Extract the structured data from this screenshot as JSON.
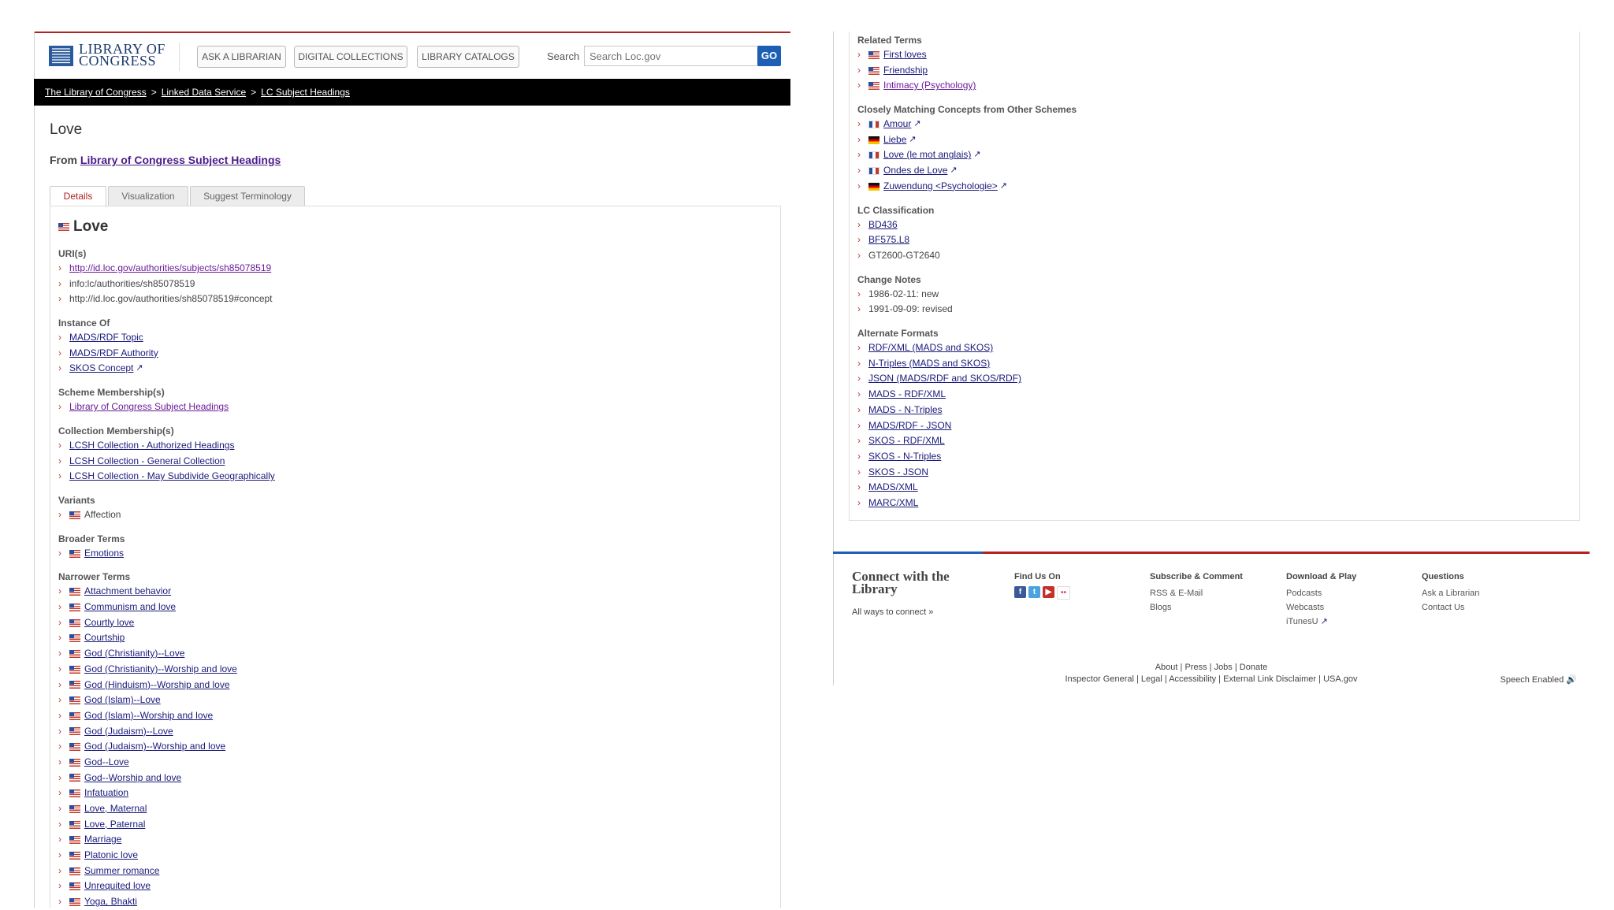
{
  "header": {
    "logo_line1": "LIBRARY OF",
    "logo_line2": "CONGRESS",
    "buttons": [
      "ASK A LIBRARIAN",
      "DIGITAL COLLECTIONS",
      "LIBRARY CATALOGS"
    ],
    "search_label": "Search",
    "search_placeholder": "Search Loc.gov",
    "go_label": "GO"
  },
  "breadcrumb": [
    "The Library of Congress",
    "Linked Data Service",
    "LC Subject Headings"
  ],
  "breadcrumb_sep": ">",
  "page_title": "Love",
  "from_label": "From",
  "from_link": "Library of Congress Subject Headings",
  "tabs": [
    "Details",
    "Visualization",
    "Suggest Terminology"
  ],
  "term_heading": "Love",
  "sections_left": [
    {
      "title": "URI(s)",
      "items": [
        {
          "text": "http://id.loc.gov/authorities/subjects/sh85078519",
          "link": true
        },
        {
          "text": "info:lc/authorities/sh85078519",
          "link": false
        },
        {
          "text": "http://id.loc.gov/authorities/sh85078519#concept",
          "link": false
        }
      ]
    },
    {
      "title": "Instance Of",
      "items": [
        {
          "text": "MADS/RDF Topic",
          "link": true
        },
        {
          "text": "MADS/RDF Authority",
          "link": true
        },
        {
          "text": "SKOS Concept",
          "link": true,
          "ext": true
        }
      ]
    },
    {
      "title": "Scheme Membership(s)",
      "items": [
        {
          "text": "Library of Congress Subject Headings",
          "link": true
        }
      ]
    },
    {
      "title": "Collection Membership(s)",
      "items": [
        {
          "text": "LCSH Collection - Authorized Headings",
          "link": true
        },
        {
          "text": "LCSH Collection - General Collection",
          "link": true
        },
        {
          "text": "LCSH Collection - May Subdivide Geographically",
          "link": true
        }
      ]
    },
    {
      "title": "Variants",
      "items": [
        {
          "text": "Affection",
          "link": false,
          "flag": "us"
        }
      ]
    },
    {
      "title": "Broader Terms",
      "items": [
        {
          "text": "Emotions",
          "link": true,
          "flag": "us"
        }
      ]
    },
    {
      "title": "Narrower Terms",
      "items": [
        {
          "text": "Attachment behavior",
          "link": true,
          "flag": "us"
        },
        {
          "text": "Communism and love",
          "link": true,
          "flag": "us"
        },
        {
          "text": "Courtly love",
          "link": true,
          "flag": "us"
        },
        {
          "text": "Courtship",
          "link": true,
          "flag": "us"
        },
        {
          "text": "God (Christianity)--Love",
          "link": true,
          "flag": "us"
        },
        {
          "text": "God (Christianity)--Worship and love",
          "link": true,
          "flag": "us"
        },
        {
          "text": "God (Hinduism)--Worship and love",
          "link": true,
          "flag": "us"
        },
        {
          "text": "God (Islam)--Love",
          "link": true,
          "flag": "us"
        },
        {
          "text": "God (Islam)--Worship and love",
          "link": true,
          "flag": "us"
        },
        {
          "text": "God (Judaism)--Love",
          "link": true,
          "flag": "us"
        },
        {
          "text": "God (Judaism)--Worship and love",
          "link": true,
          "flag": "us"
        },
        {
          "text": "God--Love",
          "link": true,
          "flag": "us"
        },
        {
          "text": "God--Worship and love",
          "link": true,
          "flag": "us"
        },
        {
          "text": "Infatuation",
          "link": true,
          "flag": "us"
        },
        {
          "text": "Love, Maternal",
          "link": true,
          "flag": "us"
        },
        {
          "text": "Love, Paternal",
          "link": true,
          "flag": "us"
        },
        {
          "text": "Marriage",
          "link": true,
          "flag": "us"
        },
        {
          "text": "Platonic love",
          "link": true,
          "flag": "us"
        },
        {
          "text": "Summer romance",
          "link": true,
          "flag": "us"
        },
        {
          "text": "Unrequited love",
          "link": true,
          "flag": "us"
        },
        {
          "text": "Yoga, Bhakti",
          "link": true,
          "flag": "us"
        }
      ]
    }
  ],
  "sections_right": [
    {
      "title": "Related Terms",
      "items": [
        {
          "text": "First loves",
          "link": true,
          "flag": "us"
        },
        {
          "text": "Friendship",
          "link": true,
          "flag": "us"
        },
        {
          "text": "Intimacy (Psychology)",
          "link": true,
          "flag": "us"
        }
      ]
    },
    {
      "title": "Closely Matching Concepts from Other Schemes",
      "items": [
        {
          "text": "Amour",
          "link": true,
          "flag": "fr",
          "ext": true
        },
        {
          "text": "Liebe",
          "link": true,
          "flag": "de",
          "ext": true
        },
        {
          "text": "Love (le mot anglais)",
          "link": true,
          "flag": "fr",
          "ext": true
        },
        {
          "text": "Ondes de Love",
          "link": true,
          "flag": "fr",
          "ext": true
        },
        {
          "text": "Zuwendung <Psychologie>",
          "link": true,
          "flag": "de",
          "ext": true
        }
      ]
    },
    {
      "title": "LC Classification",
      "items": [
        {
          "text": "BD436",
          "link": true
        },
        {
          "text": "BF575.L8",
          "link": true
        },
        {
          "text": "GT2600-GT2640",
          "link": false
        }
      ]
    },
    {
      "title": "Change Notes",
      "items": [
        {
          "text": "1986-02-11: new",
          "link": false
        },
        {
          "text": "1991-09-09: revised",
          "link": false
        }
      ]
    },
    {
      "title": "Alternate Formats",
      "items": [
        {
          "text": "RDF/XML (MADS and SKOS)",
          "link": true
        },
        {
          "text": "N-Triples (MADS and SKOS)",
          "link": true
        },
        {
          "text": "JSON (MADS/RDF and SKOS/RDF)",
          "link": true
        },
        {
          "text": "MADS - RDF/XML",
          "link": true
        },
        {
          "text": "MADS - N-Triples",
          "link": true
        },
        {
          "text": "MADS/RDF - JSON",
          "link": true
        },
        {
          "text": "SKOS - RDF/XML",
          "link": true
        },
        {
          "text": "SKOS - N-Triples",
          "link": true
        },
        {
          "text": "SKOS - JSON",
          "link": true
        },
        {
          "text": "MADS/XML",
          "link": true
        },
        {
          "text": "MARC/XML",
          "link": true
        }
      ]
    }
  ],
  "footer": {
    "connect_title": "Connect with the Library",
    "connect_link": "All ways to connect »",
    "find_us_title": "Find Us On",
    "social": [
      {
        "icon": "facebook-icon",
        "glyph": "f",
        "color": "#3b5998"
      },
      {
        "icon": "twitter-icon",
        "glyph": "t",
        "color": "#4aa3df"
      },
      {
        "icon": "youtube-icon",
        "glyph": "▶",
        "color": "#c4302b"
      },
      {
        "icon": "flickr-icon",
        "glyph": "••",
        "color": "#ffffff"
      }
    ],
    "subscribe_title": "Subscribe & Comment",
    "subscribe_items": [
      "RSS & E-Mail",
      "Blogs"
    ],
    "download_title": "Download & Play",
    "download_items": [
      "Podcasts",
      "Webcasts",
      "iTunesU"
    ],
    "questions_title": "Questions",
    "questions_items": [
      "Ask a Librarian",
      "Contact Us"
    ],
    "bottom_row1": [
      "About",
      "Press",
      "Jobs",
      "Donate"
    ],
    "bottom_row2": [
      "Inspector General",
      "Legal",
      "Accessibility",
      "External Link Disclaimer",
      "USA.gov"
    ],
    "speech": "Speech Enabled"
  },
  "colors": {
    "accent_red": "#b22222",
    "link_blue": "#1a1a7a",
    "brand_blue": "#1c5fb5"
  }
}
